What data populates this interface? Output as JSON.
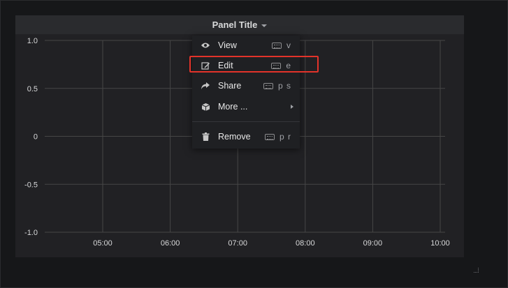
{
  "panel": {
    "title": "Panel Title"
  },
  "chart_data": {
    "type": "line",
    "title": "",
    "xlabel": "",
    "ylabel": "",
    "x_ticks": [
      "05:00",
      "06:00",
      "07:00",
      "08:00",
      "09:00",
      "10:00"
    ],
    "y_ticks": [
      1.0,
      0.5,
      0,
      -0.5,
      -1.0
    ],
    "y_tick_labels": [
      "1.0",
      "0.5",
      "0",
      "-0.5",
      "-1.0"
    ],
    "ylim": [
      -1.0,
      1.0
    ],
    "grid": true,
    "series": []
  },
  "menu": {
    "items": [
      {
        "label": "View",
        "shortcut": "v",
        "icon": "eye-icon"
      },
      {
        "label": "Edit",
        "shortcut": "e",
        "icon": "edit-icon"
      },
      {
        "label": "Share",
        "shortcut": "p s",
        "icon": "share-icon"
      },
      {
        "label": "More ...",
        "shortcut": "",
        "icon": "cube-icon"
      },
      {
        "label": "Remove",
        "shortcut": "p r",
        "icon": "trash-icon"
      }
    ]
  },
  "colors": {
    "highlight": "#e3332a",
    "grid": "#464646",
    "panel_bg": "#212124"
  }
}
